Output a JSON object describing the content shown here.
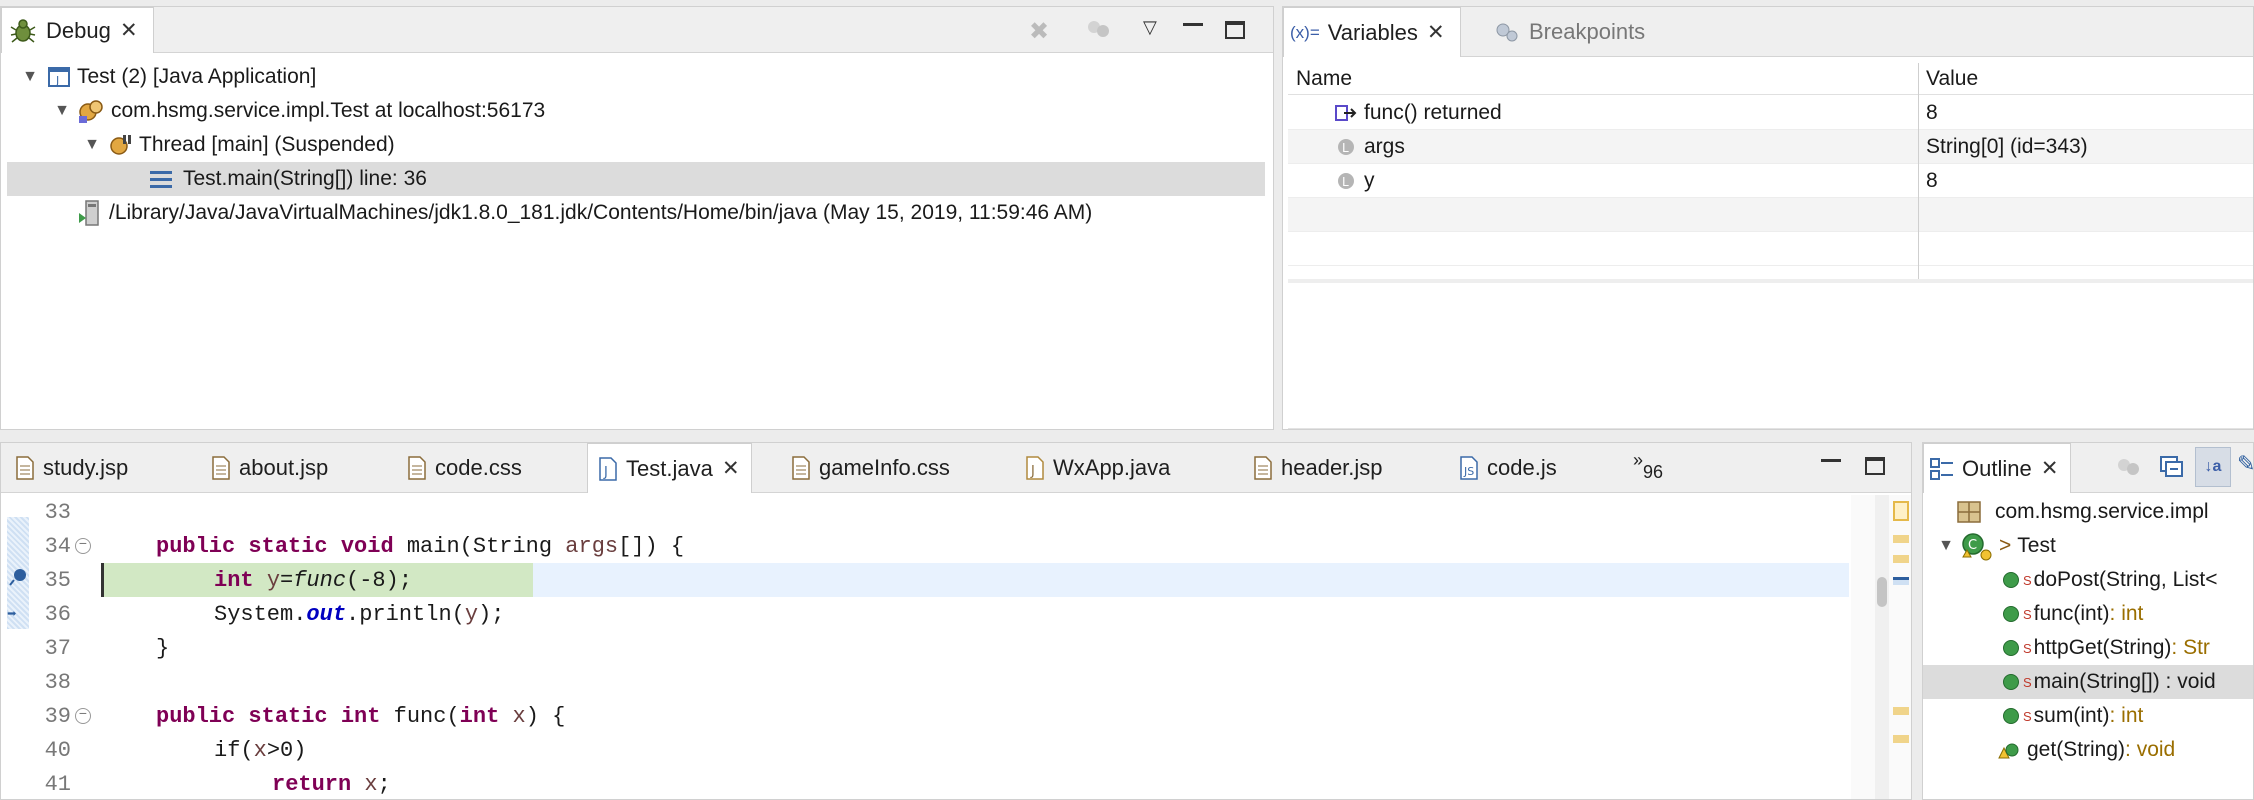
{
  "debug": {
    "tab_label": "Debug",
    "tree": [
      {
        "label": "Test (2) [Java Application]",
        "icon": "java-app-icon"
      },
      {
        "label": "com.hsmg.service.impl.Test at localhost:56173",
        "icon": "debug-target-icon"
      },
      {
        "label": "Thread [main] (Suspended)",
        "icon": "thread-suspended-icon"
      },
      {
        "label": "Test.main(String[]) line: 36",
        "icon": "stack-frame-icon"
      },
      {
        "label": "/Library/Java/JavaVirtualMachines/jdk1.8.0_181.jdk/Contents/Home/bin/java (May 15, 2019, 11:59:46 AM)",
        "icon": "process-icon"
      }
    ]
  },
  "variables": {
    "tab_label": "Variables",
    "tab_prefix": "(x)=",
    "breakpoints_label": "Breakpoints",
    "columns": {
      "name": "Name",
      "value": "Value"
    },
    "rows": [
      {
        "name": "func() returned",
        "value": "8",
        "icon": "method-result-icon"
      },
      {
        "name": "args",
        "value": "String[0]  (id=343)",
        "icon": "local-variable-icon"
      },
      {
        "name": "y",
        "value": "8",
        "icon": "local-variable-icon"
      }
    ]
  },
  "editor": {
    "tabs": [
      {
        "label": "study.jsp",
        "icon": "jsp-file-icon"
      },
      {
        "label": "about.jsp",
        "icon": "jsp-file-icon"
      },
      {
        "label": "code.css",
        "icon": "css-file-icon"
      },
      {
        "label": "Test.java",
        "icon": "java-file-icon",
        "active": true
      },
      {
        "label": "gameInfo.css",
        "icon": "css-file-icon"
      },
      {
        "label": "WxApp.java",
        "icon": "java-file-icon"
      },
      {
        "label": "header.jsp",
        "icon": "jsp-file-icon"
      },
      {
        "label": "code.js",
        "icon": "js-file-icon"
      }
    ],
    "overflow_marker": "»",
    "overflow_count": "96",
    "lines": [
      {
        "num": "33"
      },
      {
        "num": "34"
      },
      {
        "num": "35"
      },
      {
        "num": "36"
      },
      {
        "num": "37"
      },
      {
        "num": "38"
      },
      {
        "num": "39"
      },
      {
        "num": "40"
      },
      {
        "num": "41"
      }
    ],
    "code": {
      "l34_kw1": "public",
      "l34_kw2": "static",
      "l34_kw3": "void",
      "l34_rest1": " main(String ",
      "l34_var": "args",
      "l34_rest2": "[]) {",
      "l35_kw": "int",
      "l35_var": "y",
      "l35_eq": "=",
      "l35_fn": "func",
      "l35_rest": "(-8);",
      "l36_a": "System.",
      "l36_fld": "out",
      "l36_b": ".println(",
      "l36_var": "y",
      "l36_c": ");",
      "l37": "}",
      "l39_kw1": "public",
      "l39_kw2": "static",
      "l39_kw3": "int",
      "l39_rest1": " func(",
      "l39_kw4": "int",
      "l39_var": "x",
      "l39_rest2": ") {",
      "l40_a": "if(",
      "l40_var": "x",
      "l40_b": ">0)",
      "l41_kw": "return",
      "l41_var": "x",
      "l41_b": ";"
    }
  },
  "outline": {
    "tab_label": "Outline",
    "items": [
      {
        "label": "com.hsmg.service.impl",
        "ret": ""
      },
      {
        "label": "Test",
        "prefix": ">",
        "ret": ""
      },
      {
        "label": "doPost(String, List<",
        "ret": "",
        "static": "S"
      },
      {
        "label": "func(int)",
        "ret": " : int",
        "static": "S"
      },
      {
        "label": "httpGet(String)",
        "ret": " : Str",
        "static": "S"
      },
      {
        "label": "main(String[]) : void",
        "ret": "",
        "static": "S"
      },
      {
        "label": "sum(int)",
        "ret": " : int",
        "static": "S"
      },
      {
        "label": "get(String)",
        "ret": " : void",
        "static": ""
      }
    ]
  },
  "colors": {
    "keyword": "#7f0055",
    "highlight_line": "#d2e8c4",
    "selection": "#dcdcdc"
  }
}
